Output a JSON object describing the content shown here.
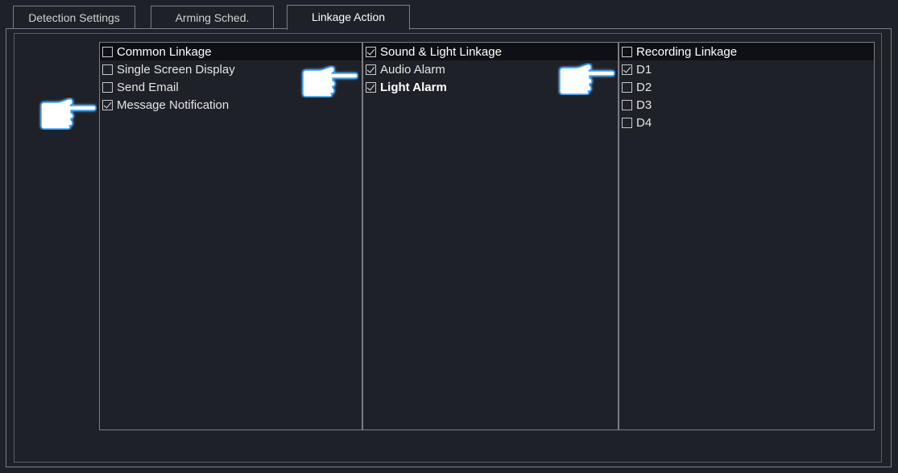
{
  "tabs": [
    {
      "label": "Detection Settings",
      "active": false
    },
    {
      "label": "Arming Sched.",
      "active": false
    },
    {
      "label": "Linkage Action",
      "active": true
    }
  ],
  "columns": [
    {
      "header": {
        "label": "Common Linkage",
        "checked": false
      },
      "items": [
        {
          "label": "Single Screen Display",
          "checked": false
        },
        {
          "label": "Send Email",
          "checked": false
        },
        {
          "label": "Message Notification",
          "checked": true
        }
      ]
    },
    {
      "header": {
        "label": "Sound & Light Linkage",
        "checked": true
      },
      "items": [
        {
          "label": "Audio Alarm",
          "checked": true
        },
        {
          "label": "Light Alarm",
          "checked": true
        }
      ]
    },
    {
      "header": {
        "label": "Recording Linkage",
        "checked": false
      },
      "items": [
        {
          "label": "D1",
          "checked": true
        },
        {
          "label": "D2",
          "checked": false
        },
        {
          "label": "D3",
          "checked": false
        },
        {
          "label": "D4",
          "checked": false
        }
      ]
    }
  ],
  "colors": {
    "background": "#1f2128",
    "header_background": "#0e1015",
    "border": "#7a7d86",
    "hand_fill": "#ffffff",
    "hand_glow": "#2aa3ff"
  },
  "icons": {
    "pointer": "pointing-hand-icon"
  }
}
